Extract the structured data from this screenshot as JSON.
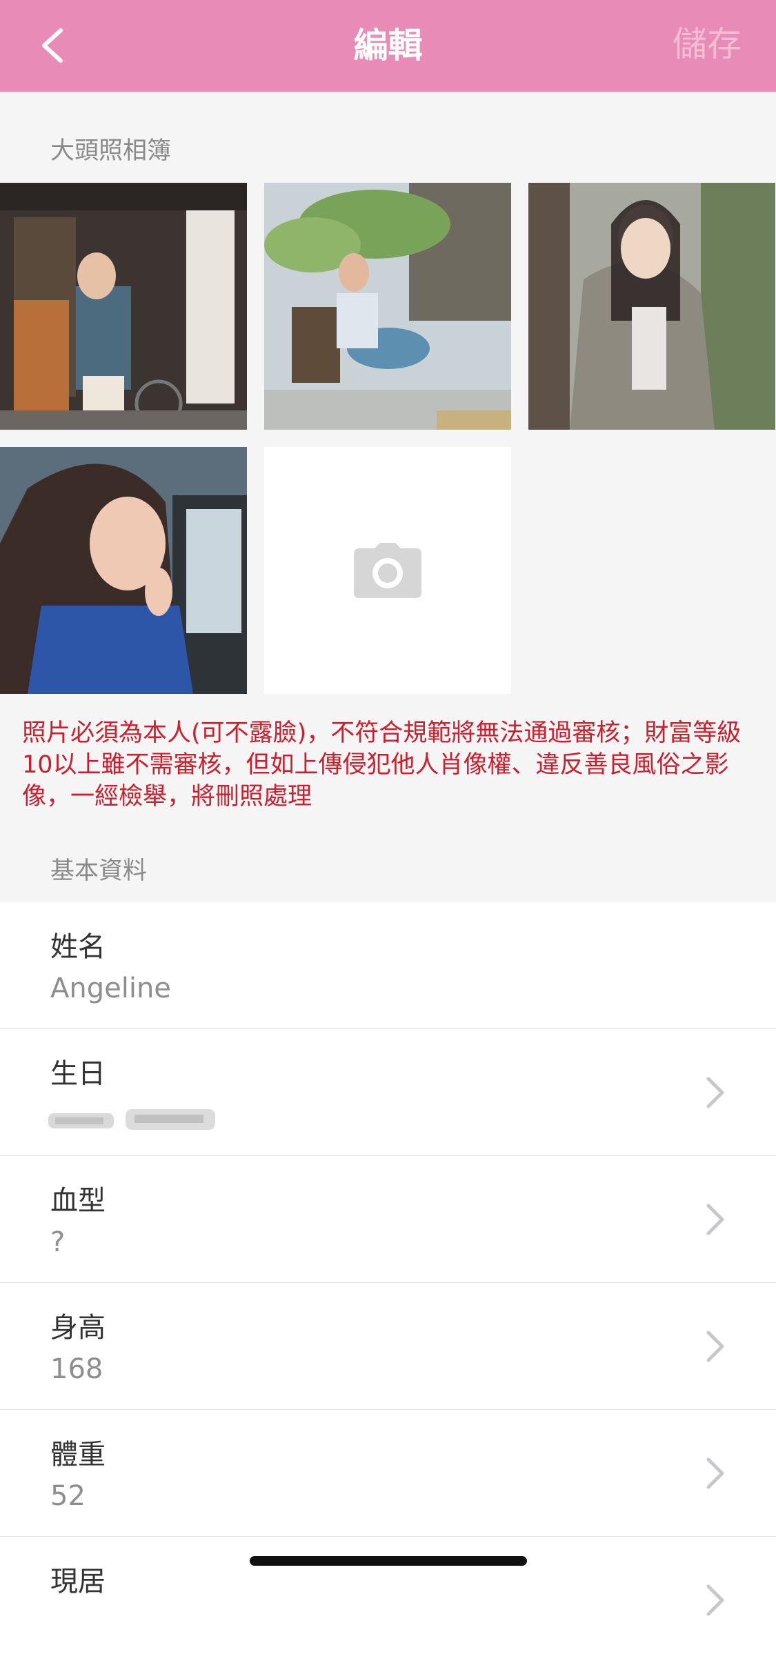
{
  "nav": {
    "title": "編輯",
    "save_label": "儲存",
    "back_icon": "chevron-left-icon",
    "bar_color": "#e88cb7"
  },
  "album": {
    "title": "大頭照相簿",
    "photos": [
      {
        "alt": "photo-1"
      },
      {
        "alt": "photo-2"
      },
      {
        "alt": "photo-3"
      },
      {
        "alt": "photo-4"
      }
    ],
    "add_icon": "camera-icon"
  },
  "notice": "照片必須為本人(可不露臉)，不符合規範將無法通過審核；財富等級10以上雖不需審核，但如上傳侵犯他人肖像權、違反善良風俗之影像，一經檢舉，將刪照處理",
  "basic": {
    "title": "基本資料",
    "fields": [
      {
        "label": "姓名",
        "value": "Angeline",
        "has_chevron": false
      },
      {
        "label": "生日",
        "value": "",
        "blurred": true,
        "has_chevron": true
      },
      {
        "label": "血型",
        "value": "?",
        "has_chevron": true
      },
      {
        "label": "身高",
        "value": "168",
        "has_chevron": true
      },
      {
        "label": "體重",
        "value": "52",
        "has_chevron": true
      },
      {
        "label": "現居",
        "value": "",
        "has_chevron": true
      }
    ]
  }
}
